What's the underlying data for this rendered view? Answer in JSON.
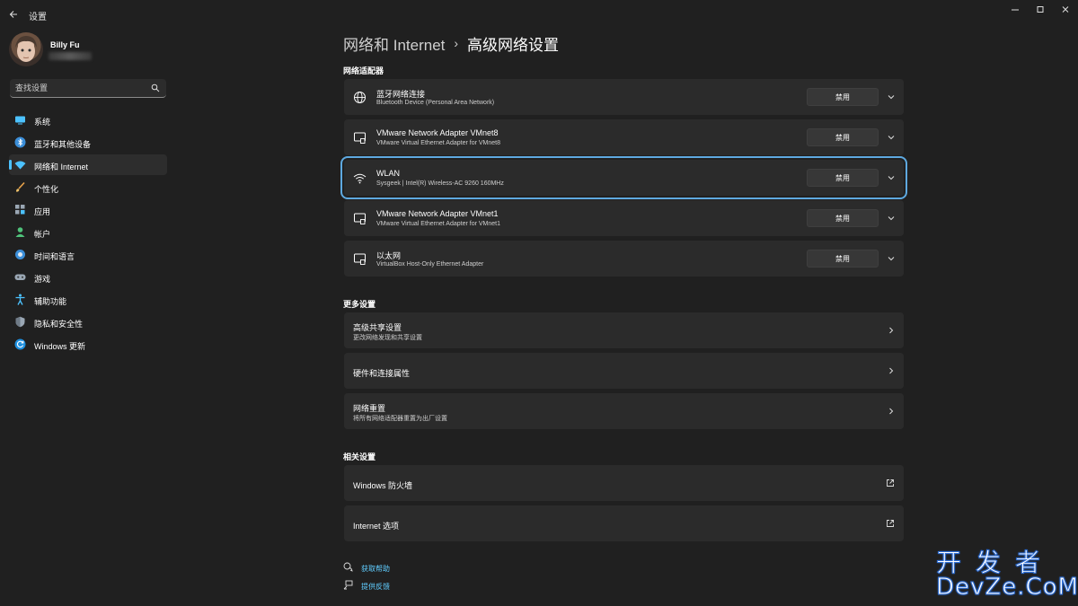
{
  "window": {
    "app_title": "设置"
  },
  "profile": {
    "name": "Billy Fu"
  },
  "search": {
    "placeholder": "查找设置"
  },
  "sidebar": {
    "items": [
      {
        "label": "系统",
        "icon": "system-icon",
        "active": false
      },
      {
        "label": "蓝牙和其他设备",
        "icon": "bluetooth-icon",
        "active": false
      },
      {
        "label": "网络和 Internet",
        "icon": "wifi-icon",
        "active": true
      },
      {
        "label": "个性化",
        "icon": "brush-icon",
        "active": false
      },
      {
        "label": "应用",
        "icon": "apps-icon",
        "active": false
      },
      {
        "label": "帐户",
        "icon": "account-icon",
        "active": false
      },
      {
        "label": "时间和语言",
        "icon": "globe-clock-icon",
        "active": false
      },
      {
        "label": "游戏",
        "icon": "gamepad-icon",
        "active": false
      },
      {
        "label": "辅助功能",
        "icon": "accessibility-icon",
        "active": false
      },
      {
        "label": "隐私和安全性",
        "icon": "shield-icon",
        "active": false
      },
      {
        "label": "Windows 更新",
        "icon": "update-icon",
        "active": false
      }
    ]
  },
  "breadcrumb": {
    "parent": "网络和 Internet",
    "separator": "›",
    "current": "高级网络设置"
  },
  "adapters": {
    "title": "网络适配器",
    "button_label": "禁用",
    "items": [
      {
        "name": "蓝牙网络连接",
        "description": "Bluetooth Device (Personal Area Network)",
        "icon": "globe-icon"
      },
      {
        "name": "VMware Network Adapter VMnet8",
        "description": "VMware Virtual Ethernet Adapter for VMnet8",
        "icon": "ethernet-icon"
      },
      {
        "name": "WLAN",
        "description": "Sysgeek | Intel(R) Wireless-AC 9260 160MHz",
        "icon": "wifi-icon",
        "highlighted": true
      },
      {
        "name": "VMware Network Adapter VMnet1",
        "description": "VMware Virtual Ethernet Adapter for VMnet1",
        "icon": "ethernet-icon"
      },
      {
        "name": "以太网",
        "description": "VirtualBox Host-Only Ethernet Adapter",
        "icon": "ethernet-icon"
      }
    ]
  },
  "more_settings": {
    "title": "更多设置",
    "items": [
      {
        "name": "高级共享设置",
        "description": "更改网络发现和共享设置"
      },
      {
        "name": "硬件和连接属性",
        "description": ""
      },
      {
        "name": "网络重置",
        "description": "将所有网络适配器重置为出厂设置"
      }
    ]
  },
  "related_settings": {
    "title": "相关设置",
    "items": [
      {
        "name": "Windows 防火墙"
      },
      {
        "name": "Internet 选项"
      }
    ]
  },
  "footer": {
    "help": "获取帮助",
    "feedback": "提供反馈"
  },
  "watermark": {
    "line1": "开发者",
    "line2": "DevZe.CoM"
  },
  "colors": {
    "background": "#202020",
    "card": "#2b2b2b",
    "accent": "#4cc2ff",
    "link": "#60cdff",
    "highlight_border": "#5ea9e0"
  }
}
